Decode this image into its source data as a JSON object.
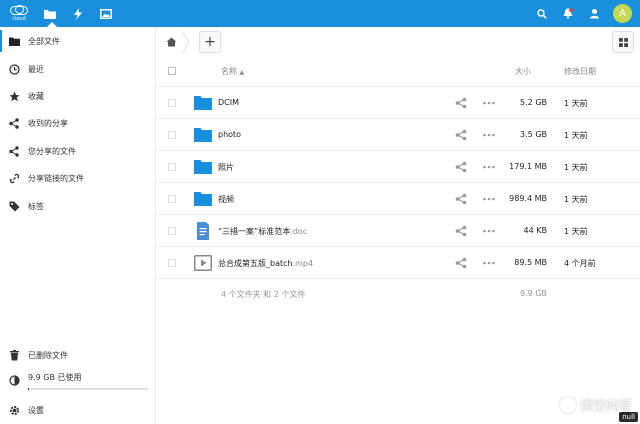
{
  "header": {
    "logo_text": "cloud",
    "apps": [
      "files-icon",
      "activity-icon",
      "gallery-icon"
    ],
    "right_icons": [
      "search-icon",
      "notifications-icon",
      "contacts-icon"
    ],
    "avatar_letter": "A",
    "bg_color": "#1a8fdb"
  },
  "sidebar": {
    "items": [
      {
        "label": "全部文件",
        "icon": "folder-icon"
      },
      {
        "label": "最近",
        "icon": "clock-icon"
      },
      {
        "label": "收藏",
        "icon": "star-icon"
      },
      {
        "label": "收到的分享",
        "icon": "share-icon"
      },
      {
        "label": "您分享的文件",
        "icon": "share-icon"
      },
      {
        "label": "分享链接的文件",
        "icon": "link-icon"
      },
      {
        "label": "标签",
        "icon": "tag-icon"
      }
    ],
    "deleted": "已删除文件",
    "quota": "9.9 GB 已使用",
    "settings": "设置"
  },
  "controls": {
    "add_label": "+"
  },
  "table": {
    "col_name": "名称",
    "col_size": "大小",
    "col_modified": "修改日期",
    "rows": [
      {
        "name": "DCIM",
        "ext": "",
        "type": "folder",
        "size": "5.2 GB",
        "date": "1 天前"
      },
      {
        "name": "photo",
        "ext": "",
        "type": "folder",
        "size": "3.5 GB",
        "date": "1 天前"
      },
      {
        "name": "照片",
        "ext": "",
        "type": "folder",
        "size": "179.1 MB",
        "date": "1 天前"
      },
      {
        "name": "视频",
        "ext": "",
        "type": "folder",
        "size": "989.4 MB",
        "date": "1 天前"
      },
      {
        "name": "“三措一案”标准范本",
        "ext": ".doc",
        "type": "doc",
        "size": "44 KB",
        "date": "1 天前"
      },
      {
        "name": "总合成第五版_batch",
        "ext": ".mp4",
        "type": "video",
        "size": "89.5 MB",
        "date": "4 个月前"
      }
    ],
    "summary_text": "4 个文件夹 和 2 个文件",
    "summary_size": "9.9 GB"
  },
  "watermark": {
    "text": "悟空问答",
    "tag": "null"
  }
}
